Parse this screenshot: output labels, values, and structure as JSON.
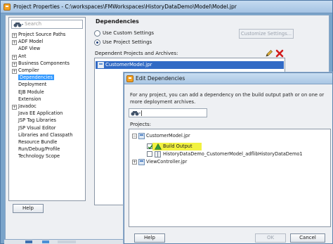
{
  "main_window": {
    "title": "Project Properties - C:\\workspaces\\FMWorkspaces\\HistoryDataDemo\\Model\\Model.jpr",
    "search_placeholder": "Search",
    "tree_items": [
      {
        "label": "Project Source Paths",
        "toggle": "+"
      },
      {
        "label": "ADF Model",
        "toggle": "+"
      },
      {
        "label": "ADF View",
        "toggle": ""
      },
      {
        "label": "Ant",
        "toggle": "+"
      },
      {
        "label": "Business Components",
        "toggle": "+"
      },
      {
        "label": "Compiler",
        "toggle": "+"
      },
      {
        "label": "Dependencies",
        "toggle": "",
        "selected": true
      },
      {
        "label": "Deployment",
        "toggle": ""
      },
      {
        "label": "EJB Module",
        "toggle": ""
      },
      {
        "label": "Extension",
        "toggle": ""
      },
      {
        "label": "Javadoc",
        "toggle": "+"
      },
      {
        "label": "Java EE Application",
        "toggle": ""
      },
      {
        "label": "JSP Tag Libraries",
        "toggle": ""
      },
      {
        "label": "JSP Visual Editor",
        "toggle": ""
      },
      {
        "label": "Libraries and Classpath",
        "toggle": ""
      },
      {
        "label": "Resource Bundle",
        "toggle": ""
      },
      {
        "label": "Run/Debug/Profile",
        "toggle": ""
      },
      {
        "label": "Technology Scope",
        "toggle": ""
      }
    ],
    "section_title": "Dependencies",
    "radio_custom": "Use Custom Settings",
    "radio_project": "Use Project Settings",
    "customize_button": "Customize Settings...",
    "list_label": "Dependent Projects and Archives:",
    "list_item": "CustomerModel.jpr",
    "help_button": "Help"
  },
  "edit_dialog": {
    "title": "Edit Dependencies",
    "description": "For any project, you can add a dependency on the build output path or on one or more deployment archives.",
    "projects_label": "Projects:",
    "tree": {
      "project1": "CustomerModel.jpr",
      "build_output": "Build Output",
      "archive": "HistoryDataDemo_CustomerModel_adflibHistoryDataDemo1",
      "project2": "ViewController.jpr"
    },
    "help_button": "Help",
    "ok_button": "OK",
    "cancel_button": "Cancel"
  },
  "colors": {
    "title_bar": "#a4c3e3",
    "selection": "#316ac5",
    "highlight": "#f2f240",
    "frame": "#7aa4ca"
  }
}
